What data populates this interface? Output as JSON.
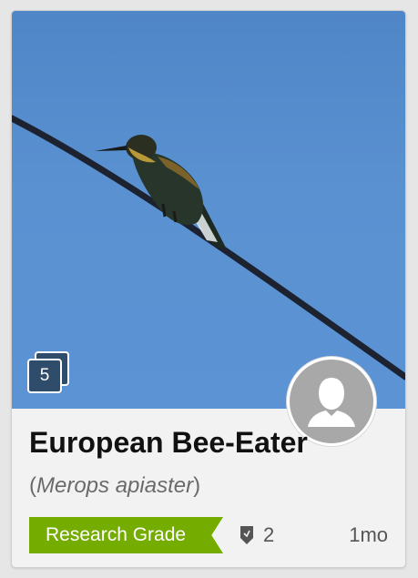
{
  "observation": {
    "common_name": "European Bee-Eater",
    "scientific_name": "Merops apiaster",
    "paren_open": "(",
    "paren_close": ")",
    "photo_count": "5",
    "quality_grade": "Research Grade",
    "identification_count": "2",
    "time_ago": "1mo"
  },
  "icons": {
    "photo_stack": "photo-stack-icon",
    "avatar": "user-silhouette-icon",
    "identifications": "identification-shield-icon"
  },
  "colors": {
    "research_grade": "#74ac00",
    "badge_bg": "#2f4c6b",
    "avatar_bg": "#a8a8a8",
    "sky": "#5a91d1"
  }
}
